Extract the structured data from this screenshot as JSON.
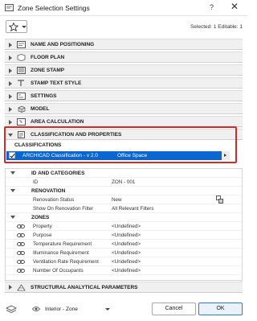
{
  "window": {
    "title": "Zone Selection Settings",
    "help_glyph": "?",
    "close_glyph": "✕"
  },
  "toolbar": {
    "favorites_icon": "star-icon",
    "selected_info": "Selected: 1 Editable: 1"
  },
  "panels": [
    {
      "label": "NAME AND POSITIONING",
      "icon": "name-position-icon",
      "expanded": false
    },
    {
      "label": "FLOOR PLAN",
      "icon": "floor-plan-icon",
      "expanded": false
    },
    {
      "label": "ZONE STAMP",
      "icon": "zone-stamp-icon",
      "expanded": false
    },
    {
      "label": "STAMP TEXT STYLE",
      "icon": "text-style-icon",
      "expanded": false
    },
    {
      "label": "SETTINGS",
      "icon": "settings-icon",
      "expanded": false
    },
    {
      "label": "MODEL",
      "icon": "model-icon",
      "expanded": false
    },
    {
      "label": "AREA CALCULATION",
      "icon": "area-calc-icon",
      "expanded": false
    },
    {
      "label": "CLASSIFICATION AND PROPERTIES",
      "icon": "classification-icon",
      "expanded": true
    }
  ],
  "classification": {
    "header": "CLASSIFICATIONS",
    "system": "ARCHICAD Classification - v 2.0",
    "value": "Office Space",
    "checked": true
  },
  "properties": [
    {
      "type": "group",
      "label": "ID AND CATEGORIES"
    },
    {
      "type": "item",
      "name": "ID",
      "value": "ZON - 001"
    },
    {
      "type": "group",
      "label": "RENOVATION"
    },
    {
      "type": "item",
      "name": "Renovation Status",
      "value": "New",
      "icon": "renovation-icon"
    },
    {
      "type": "item",
      "name": "Show On Renovation Filter",
      "value": "All Relevant Filters"
    },
    {
      "type": "group",
      "label": "ZONES"
    },
    {
      "type": "item",
      "name": "Property",
      "value": "<Undefined>",
      "linked": true
    },
    {
      "type": "item",
      "name": "Purpose",
      "value": "<Undefined>",
      "linked": true
    },
    {
      "type": "item",
      "name": "Temperature Requirement",
      "value": "<Undefined>",
      "linked": true
    },
    {
      "type": "item",
      "name": "Illuminance Requirement",
      "value": "<Undefined>",
      "linked": true
    },
    {
      "type": "item",
      "name": "Ventilation Rate Requirement",
      "value": "<Undefined>",
      "linked": true
    },
    {
      "type": "item",
      "name": "Number Of Occupants",
      "value": "<Undefined>",
      "linked": true
    }
  ],
  "bottom_panel": {
    "label": "STRUCTURAL ANALYTICAL PARAMETERS",
    "icon": "structural-icon"
  },
  "footer": {
    "layer_label": "Interior - Zone",
    "cancel": "Cancel",
    "ok": "OK"
  },
  "colors": {
    "selection": "#0a66d1",
    "highlight_box": "#d32a2a"
  }
}
